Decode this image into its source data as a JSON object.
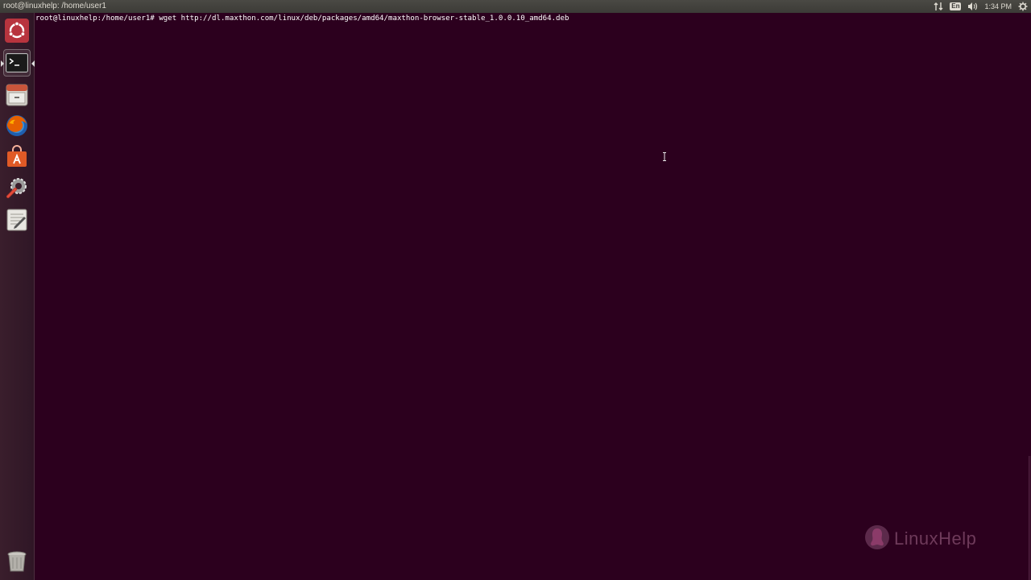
{
  "top_panel": {
    "window_title": "root@linuxhelp: /home/user1",
    "keyboard_layout": "En",
    "clock": "1:34 PM"
  },
  "launcher": {
    "items": [
      {
        "name": "dash-home",
        "icon": "ubuntu-logo-icon"
      },
      {
        "name": "terminal",
        "icon": "terminal-icon",
        "running": true,
        "focused": true
      },
      {
        "name": "files",
        "icon": "file-cabinet-icon"
      },
      {
        "name": "firefox",
        "icon": "firefox-icon"
      },
      {
        "name": "software-center",
        "icon": "shopping-bag-icon"
      },
      {
        "name": "system-settings",
        "icon": "settings-wrench-icon"
      },
      {
        "name": "text-editor",
        "icon": "text-editor-icon"
      },
      {
        "name": "trash",
        "icon": "trash-icon"
      }
    ]
  },
  "terminal": {
    "prompt": "root@linuxhelp:/home/user1#",
    "command": "wget http://dl.maxthon.com/linux/deb/packages/amd64/maxthon-browser-stable_1.0.0.10_amd64.deb",
    "background_color": "#2c001e",
    "text_color": "#ffffff"
  },
  "watermark": {
    "text": "LinuxHelp"
  }
}
